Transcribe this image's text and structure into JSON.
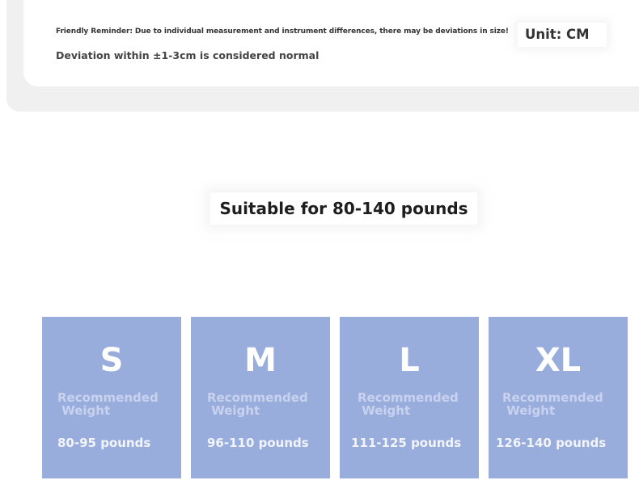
{
  "reminder_line": "Friendly Reminder: Due to individual measurement and instrument differences, there may be deviations in size!",
  "deviation_line": "Deviation within ±1-3cm is considered normal",
  "unit_label": "Unit: CM",
  "suitable_heading": "Suitable for 80-140 pounds",
  "colors": {
    "card_bg": "#99addd",
    "heading_text": "#1e1e1e"
  },
  "sizes": [
    {
      "size": "S",
      "label": "Recommended\n Weight",
      "range": "80-95 pounds"
    },
    {
      "size": "M",
      "label": "Recommended\n Weight",
      "range": "96-110 pounds"
    },
    {
      "size": "L",
      "label": "Recommended\n Weight",
      "range": "111-125 pounds"
    },
    {
      "size": "XL",
      "label": "Recommended\n Weight",
      "range": "126-140 pounds"
    }
  ]
}
